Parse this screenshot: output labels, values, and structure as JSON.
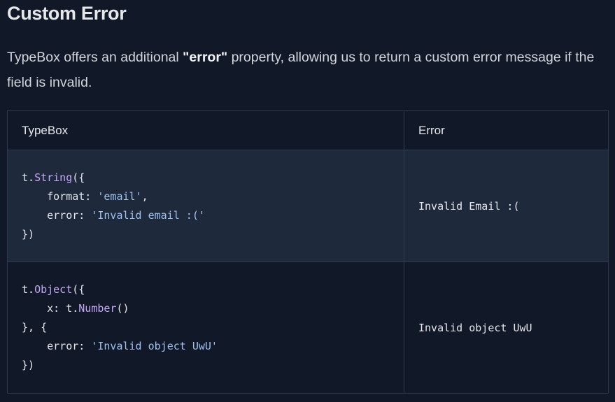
{
  "heading": "Custom Error",
  "intro": {
    "before": "TypeBox offers an additional ",
    "bold": "\"error\"",
    "after": " property, allowing us to return a custom error message if the field is invalid."
  },
  "table": {
    "headers": [
      "TypeBox",
      "Error"
    ],
    "rows": [
      {
        "code": {
          "l1_pre": "t.",
          "l1_fn": "String",
          "l1_post": "({",
          "l2_pre": "    format: ",
          "l2_str": "'email'",
          "l2_post": ",",
          "l3_pre": "    error: ",
          "l3_str": "'Invalid email :('",
          "l4": "})"
        },
        "error": "Invalid Email :("
      },
      {
        "code": {
          "l1_pre": "t.",
          "l1_fn": "Object",
          "l1_post": "({",
          "l2_pre": "    x: t.",
          "l2_fn": "Number",
          "l2_post": "()",
          "l3": "}, {",
          "l4_pre": "    error: ",
          "l4_str": "'Invalid object UwU'",
          "l5": "})"
        },
        "error": "Invalid object UwU"
      }
    ]
  },
  "colors": {
    "background": "#111827",
    "row_alt": "#1e293b",
    "border": "#2e3a4e",
    "function": "#c4a6f5",
    "string": "#9fc3f0"
  }
}
